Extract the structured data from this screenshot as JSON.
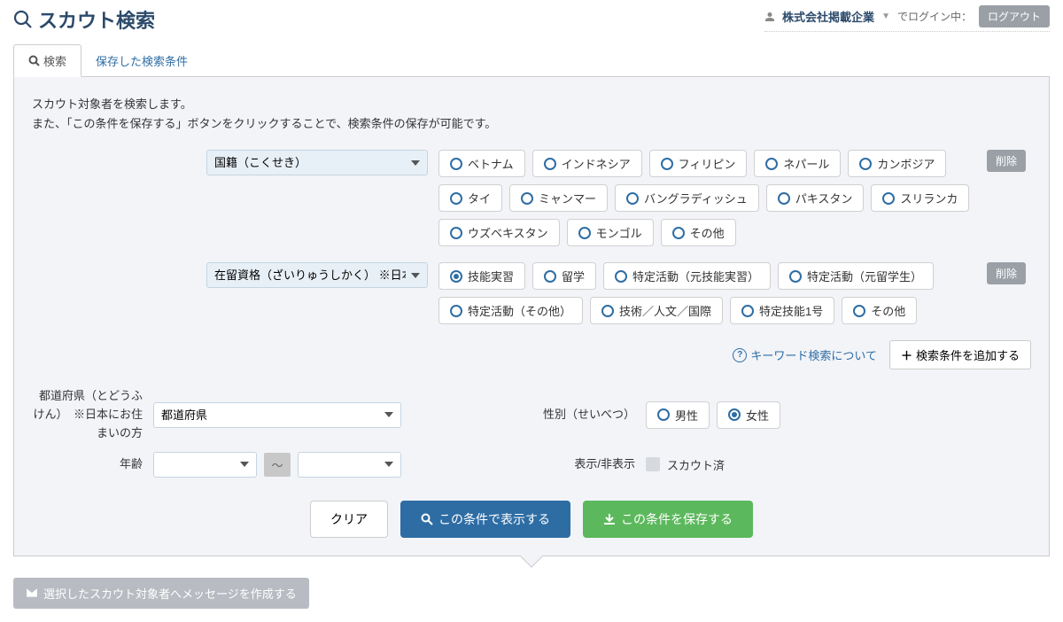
{
  "header": {
    "title": "スカウト検索",
    "company": "株式会社掲載企業",
    "login_status": "でログイン中：",
    "logout": "ログアウト"
  },
  "tabs": {
    "search": "検索",
    "saved": "保存した検索条件"
  },
  "desc_line1": "スカウト対象者を検索します。",
  "desc_line2": "また、「この条件を保存する」ボタンをクリックすることで、検索条件の保存が可能です。",
  "filter1": {
    "select_value": "国籍（こくせき）",
    "options": [
      "ベトナム",
      "インドネシア",
      "フィリピン",
      "ネパール",
      "カンボジア",
      "タイ",
      "ミャンマー",
      "バングラディッシュ",
      "パキスタン",
      "スリランカ",
      "ウズベキスタン",
      "モンゴル",
      "その他"
    ],
    "delete": "削除"
  },
  "filter2": {
    "select_value": "在留資格（ざいりゅうしかく） ※日本にお",
    "options": [
      "技能実習",
      "留学",
      "特定活動（元技能実習）",
      "特定活動（元留学生）",
      "特定活動（その他）",
      "技術／人文／国際",
      "特定技能1号",
      "その他"
    ],
    "selected_index": 0,
    "delete": "削除"
  },
  "add": {
    "keyword_link": "キーワード検索について",
    "add_button": "検索条件を追加する"
  },
  "form": {
    "prefecture_label": "都道府県（とどうふけん）　※日本にお住まいの方",
    "prefecture_value": "都道府県",
    "gender_label": "性別（せいべつ）",
    "gender_male": "男性",
    "gender_female": "女性",
    "age_label": "年齢",
    "show_label": "表示/非表示",
    "scout_done": "スカウト済"
  },
  "actions": {
    "clear": "クリア",
    "search": "この条件で表示する",
    "save": "この条件を保存する"
  },
  "footer": {
    "compose": "選択したスカウト対象者へメッセージを作成する"
  }
}
